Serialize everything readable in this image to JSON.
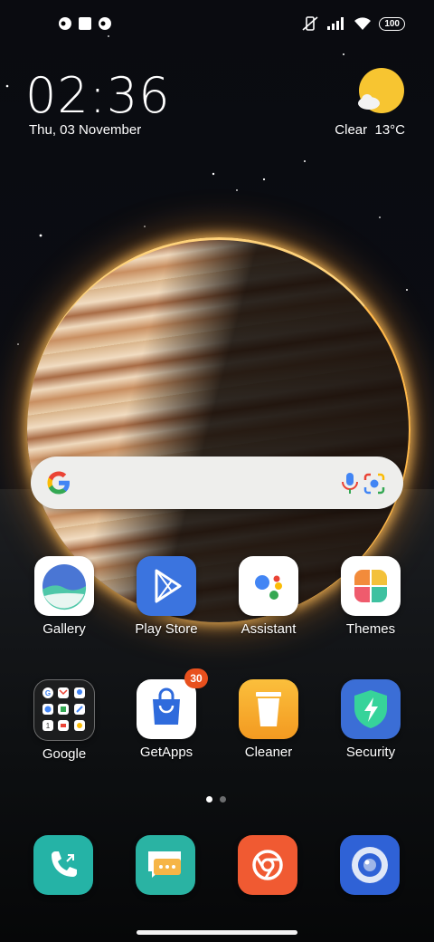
{
  "status_bar": {
    "left_icons": [
      "notification-icon",
      "square-notification-icon",
      "notification-icon"
    ],
    "right_icons": [
      "vibrate-off-icon",
      "signal-icon",
      "wifi-icon"
    ],
    "battery": "100"
  },
  "clock": {
    "time": "02:36",
    "date": "Thu, 03 November"
  },
  "weather": {
    "condition": "Clear",
    "temperature": "13°C",
    "icon": "sun-cloud-icon"
  },
  "search": {
    "icons": [
      "google-g-icon",
      "mic-icon",
      "lens-icon"
    ]
  },
  "apps": [
    {
      "label": "Gallery",
      "icon": "gallery-icon"
    },
    {
      "label": "Play Store",
      "icon": "play-store-icon"
    },
    {
      "label": "Assistant",
      "icon": "assistant-icon"
    },
    {
      "label": "Themes",
      "icon": "themes-icon"
    },
    {
      "label": "Google",
      "icon": "google-folder-icon"
    },
    {
      "label": "GetApps",
      "icon": "getapps-icon",
      "badge": "30"
    },
    {
      "label": "Cleaner",
      "icon": "cleaner-icon"
    },
    {
      "label": "Security",
      "icon": "security-icon"
    }
  ],
  "page_indicator": {
    "pages": 2,
    "current": 1
  },
  "dock": [
    {
      "icon": "phone-icon"
    },
    {
      "icon": "messages-icon"
    },
    {
      "icon": "browser-icon"
    },
    {
      "icon": "camera-icon"
    }
  ],
  "colors": {
    "accent_orange": "#e8501d",
    "sun": "#f7c531",
    "security_green": "#37d39a"
  }
}
